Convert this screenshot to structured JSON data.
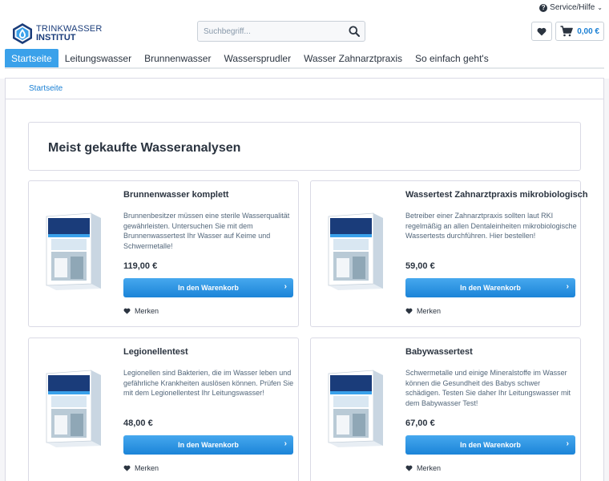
{
  "header": {
    "service_label": "Service/Hilfe",
    "logo_line1": "TRINKWASSER",
    "logo_line2": "INSTITUT",
    "search_placeholder": "Suchbegriff...",
    "cart_amount": "0,00 €"
  },
  "nav": {
    "items": [
      "Startseite",
      "Leitungswasser",
      "Brunnenwasser",
      "Wassersprudler",
      "Wasser Zahnarztpraxis",
      "So einfach geht's"
    ],
    "active_index": 0
  },
  "breadcrumb": "Startseite",
  "section_title": "Meist gekaufte Wasseranalysen",
  "products": [
    {
      "title": "Brunnenwasser komplett",
      "description": "Brunnenbesitzer müssen eine sterile Wasserqualität gewährleisten. Untersuchen Sie mit dem Brunnenwassertest Ihr Wasser auf Keime und Schwermetalle!",
      "price": "119,00 €",
      "button": "In den Warenkorb",
      "wishlist": "Merken"
    },
    {
      "title": "Wassertest Zahnarztpraxis mikrobiologisch",
      "description": "Betreiber einer Zahnarztpraxis sollten laut RKI regelmäßig an allen Dentaleinheiten mikrobiologische Wassertests durchführen. Hier bestellen!",
      "price": "59,00 €",
      "button": "In den Warenkorb",
      "wishlist": "Merken"
    },
    {
      "title": "Legionellentest",
      "description": "Legionellen sind Bakterien, die im Wasser leben und gefährliche Krankheiten auslösen können. Prüfen Sie mit dem Legionellentest Ihr Leitungswasser!",
      "price": "48,00 €",
      "button": "In den Warenkorb",
      "wishlist": "Merken"
    },
    {
      "title": "Babywassertest",
      "description": "Schwermetalle und einige Mineralstoffe im Wasser können die Gesundheit des Babys schwer schädigen. Testen Sie daher Ihr Leitungswasser mit dem Babywasser Test!",
      "price": "67,00 €",
      "button": "In den Warenkorb",
      "wishlist": "Merken"
    }
  ],
  "colors": {
    "accent": "#3aa1ea",
    "button": "#1b84d8",
    "brand": "#1a3c7a",
    "heading": "#2b3440"
  }
}
